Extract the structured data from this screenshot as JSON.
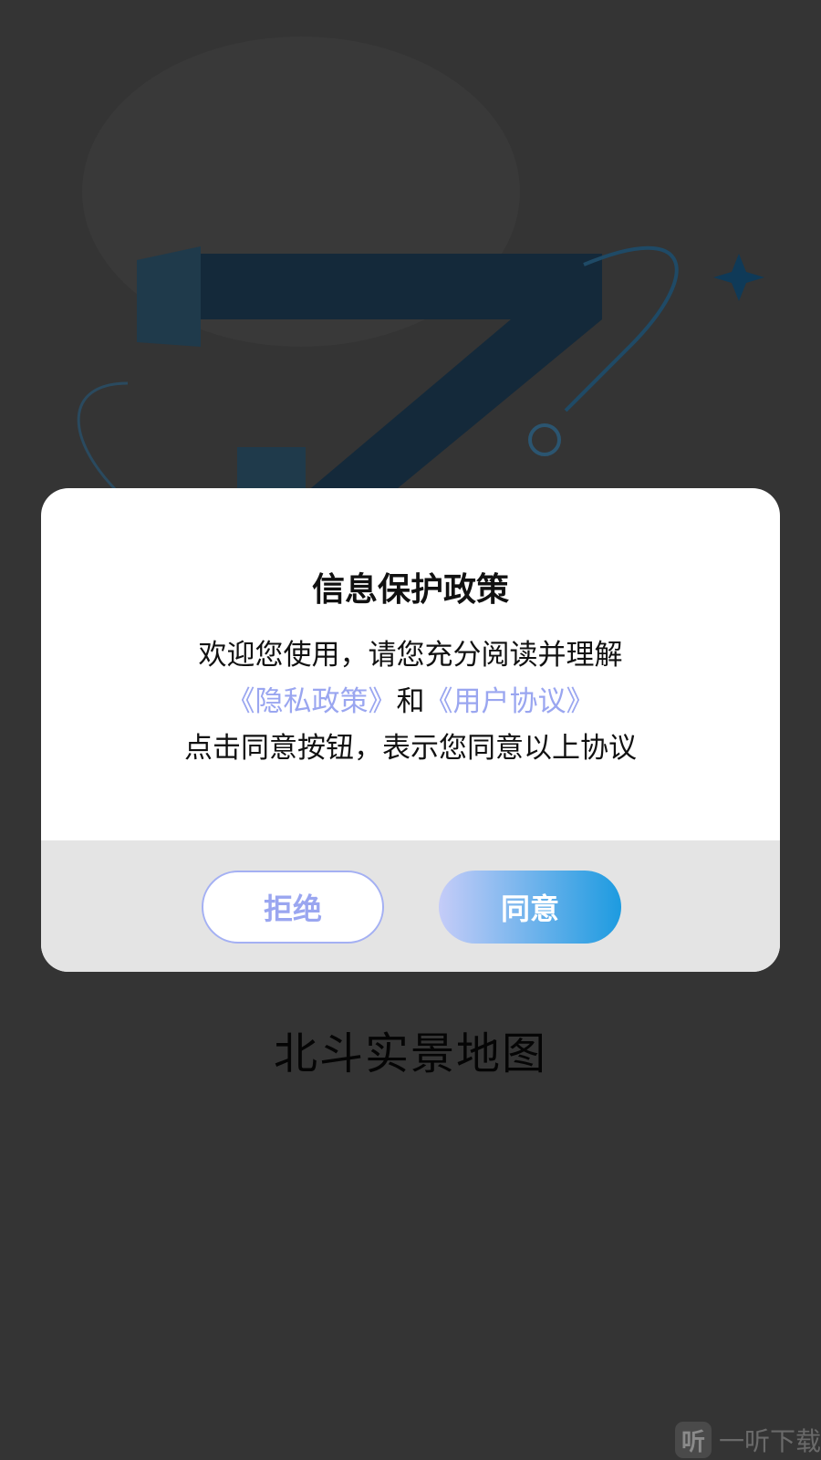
{
  "dialog": {
    "title": "信息保护政策",
    "line1": "欢迎您使用，请您充分阅读并理解",
    "privacy_link": "《隐私政策》",
    "conjunction": "和",
    "terms_link": "《用户协议》",
    "line3": "点击同意按钮，表示您同意以上协议",
    "reject_label": "拒绝",
    "agree_label": "同意"
  },
  "app": {
    "name": "北斗实景地图"
  },
  "watermark": {
    "logo_char": "听",
    "text": "一听下载"
  },
  "colors": {
    "overlay_bg": "#343434",
    "link": "#9aa6f0",
    "agree_gradient_start": "#c5ccf8",
    "agree_gradient_end": "#1d9be0",
    "footer_bg": "#e4e4e4"
  }
}
